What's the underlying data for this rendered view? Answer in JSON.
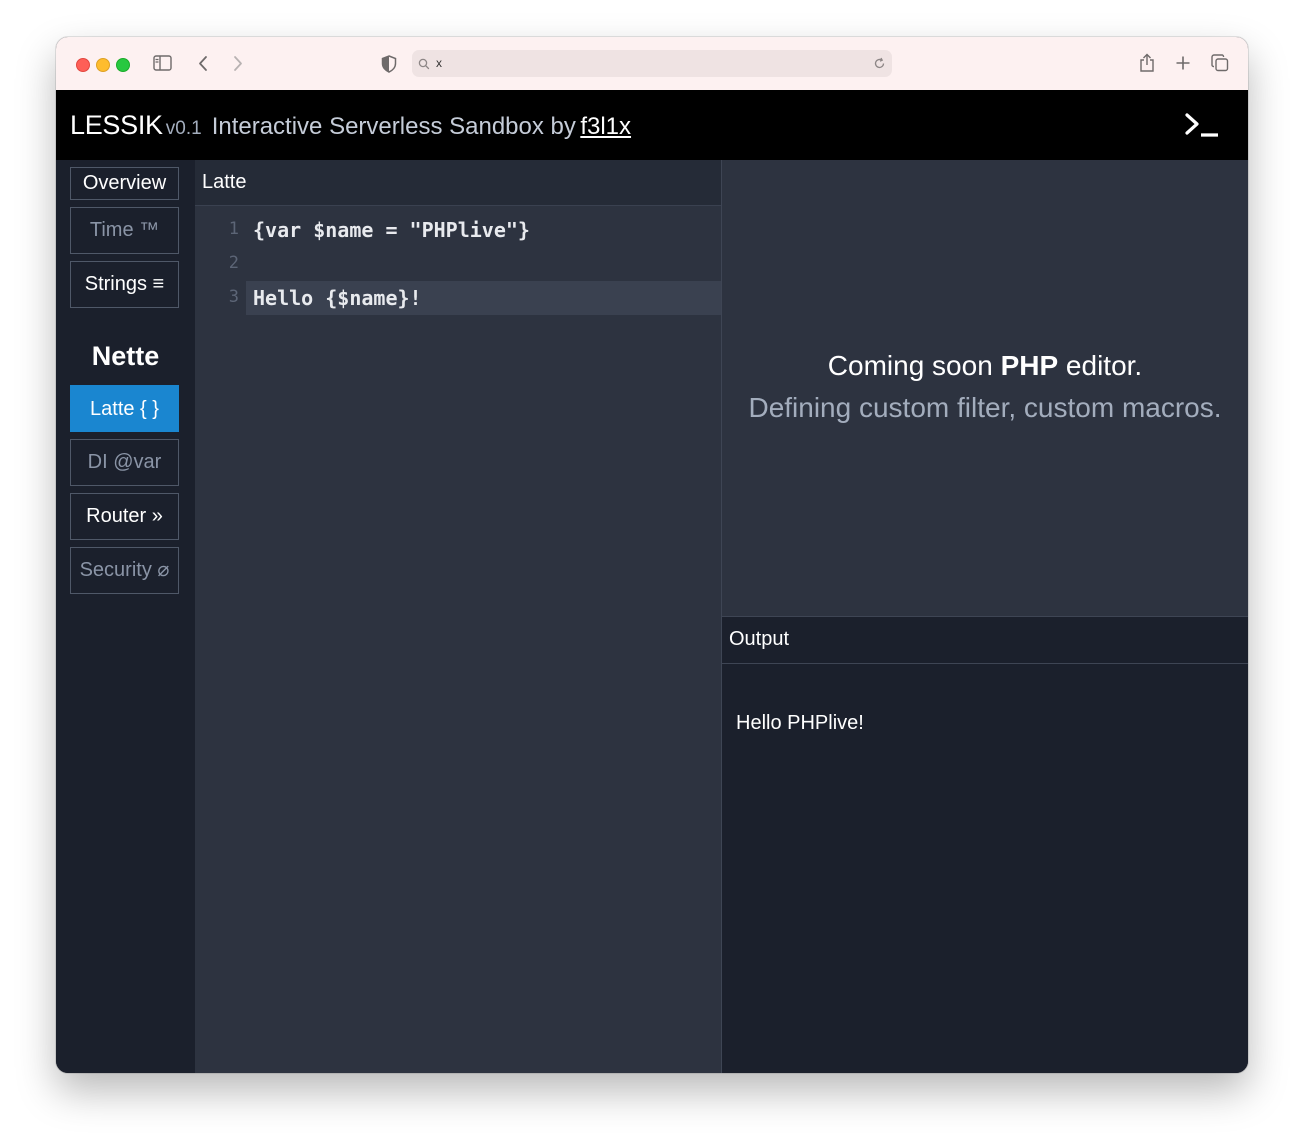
{
  "browser": {
    "url": "x",
    "colors": {
      "close": "#fe5f57",
      "minimize": "#febc2e",
      "zoom": "#28c840"
    },
    "icons": [
      "sidebar-icon",
      "back-icon",
      "forward-icon",
      "shield-icon",
      "search-icon",
      "reload-icon",
      "share-icon",
      "new-tab-icon",
      "tabs-overview-icon"
    ]
  },
  "header": {
    "app_name": "LESSIK",
    "version": "v0.1",
    "tagline": "Interactive Serverless Sandbox by",
    "author": "f3l1x",
    "icon": "terminal-icon"
  },
  "sidebar": {
    "items_top": [
      {
        "label": "Overview",
        "state": "default"
      },
      {
        "label": "Time ™",
        "state": "muted"
      },
      {
        "label": "Strings ≡",
        "state": "default"
      }
    ],
    "section_heading": "Nette",
    "items_nette": [
      {
        "label": "Latte { }",
        "state": "active"
      },
      {
        "label": "DI @var",
        "state": "muted"
      },
      {
        "label": "Router »",
        "state": "default"
      },
      {
        "label": "Security ⌀",
        "state": "muted"
      }
    ]
  },
  "editor": {
    "title": "Latte",
    "lines": [
      {
        "number": "1",
        "text": "{var $name = \"PHPlive\"}"
      },
      {
        "number": "2",
        "text": ""
      },
      {
        "number": "3",
        "text": "Hello {$name}!"
      }
    ],
    "active_line": 3
  },
  "php_panel": {
    "line1_prefix": "Coming soon",
    "line1_bold": "PHP",
    "line1_suffix": "editor.",
    "line2": "Defining custom filter, custom macros."
  },
  "output": {
    "title": "Output",
    "text": "Hello PHPlive!"
  },
  "theme": {
    "accent": "#1a86d0",
    "header_bg": "#000000",
    "panel_bg": "#2d3340",
    "sidebar_bg": "#1b202c"
  }
}
